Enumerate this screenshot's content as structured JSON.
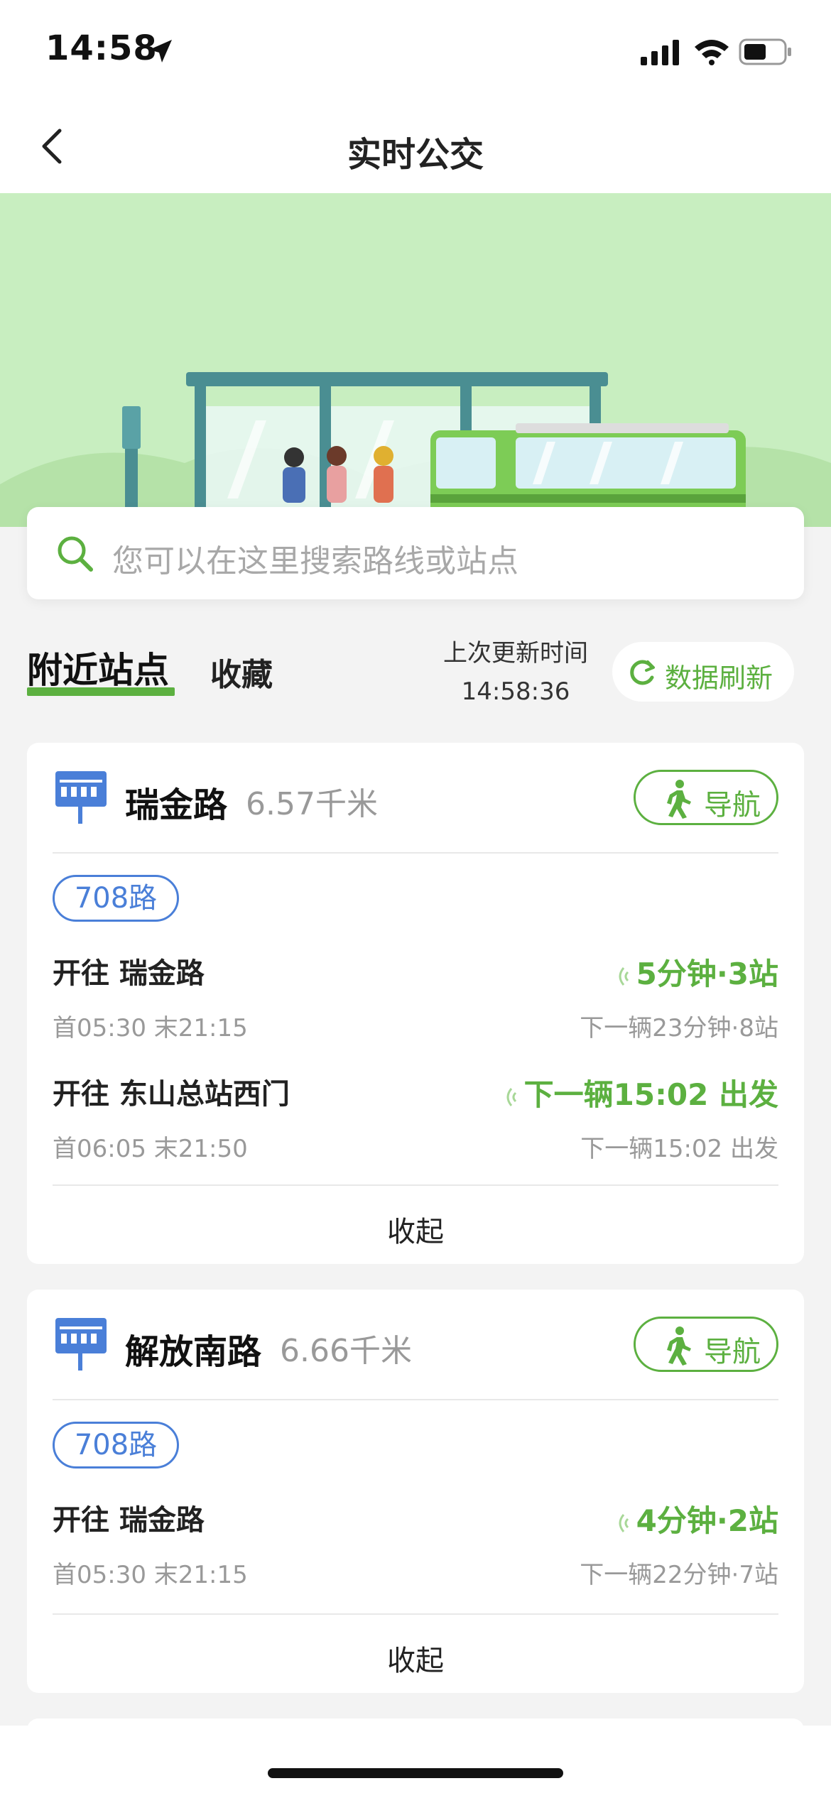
{
  "status": {
    "time": "14:58"
  },
  "nav": {
    "title": "实时公交"
  },
  "search": {
    "placeholder": "您可以在这里搜索路线或站点"
  },
  "tabs": {
    "nearby": "附近站点",
    "favorites": "收藏"
  },
  "update": {
    "label": "上次更新时间",
    "time": "14:58:36",
    "refresh_label": "数据刷新"
  },
  "stations": [
    {
      "name": "瑞金路",
      "distance": "6.57千米",
      "nav_label": "导航",
      "route": "708路",
      "directions": [
        {
          "dest": "开往 瑞金路",
          "times": "首05:30 末21:15",
          "eta": "5分钟·3站",
          "next": "下一辆23分钟·8站"
        },
        {
          "dest": "开往 东山总站西门",
          "times": "首06:05 末21:50",
          "eta": "下一辆15:02 出发",
          "next": "下一辆15:02 出发"
        }
      ],
      "collapse_label": "收起"
    },
    {
      "name": "解放南路",
      "distance": "6.66千米",
      "nav_label": "导航",
      "route": "708路",
      "directions": [
        {
          "dest": "开往 瑞金路",
          "times": "首05:30 末21:15",
          "eta": "4分钟·2站",
          "next": "下一辆22分钟·7站"
        }
      ],
      "collapse_label": "收起"
    }
  ],
  "colors": {
    "accent": "#5cb040",
    "route_blue": "#4a7fd8",
    "banner": "#c8eec0"
  },
  "icons": {
    "back": "chevron-left-icon",
    "search": "search-icon",
    "refresh": "refresh-icon",
    "station": "bus-stop-icon",
    "walk": "walking-icon",
    "signal": "realtime-signal-icon"
  }
}
